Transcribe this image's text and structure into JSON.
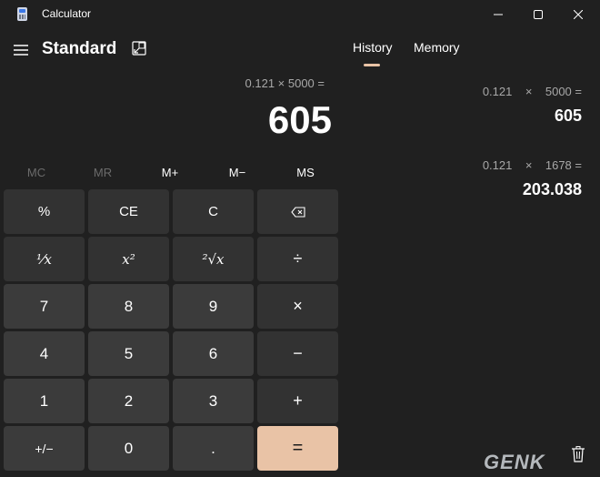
{
  "window": {
    "title": "Calculator",
    "minimize_icon": "minimize-icon",
    "maximize_icon": "maximize-icon",
    "close_icon": "close-icon"
  },
  "header": {
    "mode": "Standard",
    "tabs": [
      "History",
      "Memory"
    ],
    "active_tab": "History"
  },
  "display": {
    "expression": "0.121 × 5000 =",
    "result": "605"
  },
  "memory_row": [
    {
      "label": "MC",
      "enabled": false
    },
    {
      "label": "MR",
      "enabled": false
    },
    {
      "label": "M+",
      "enabled": true
    },
    {
      "label": "M−",
      "enabled": true
    },
    {
      "label": "MS",
      "enabled": true
    }
  ],
  "keys": {
    "percent": "%",
    "clear_entry": "CE",
    "clear": "C",
    "backspace_icon": "backspace-icon",
    "reciprocal": "⅟x",
    "square": "x²",
    "square_root": "²√x",
    "divide": "÷",
    "seven": "7",
    "eight": "8",
    "nine": "9",
    "multiply": "×",
    "four": "4",
    "five": "5",
    "six": "6",
    "minus": "−",
    "one": "1",
    "two": "2",
    "three": "3",
    "plus": "+",
    "negate": "+/−",
    "zero": "0",
    "decimal": ".",
    "equals": "="
  },
  "history": [
    {
      "expression_a": "0.121",
      "operator": "×",
      "expression_b": "5000",
      "equals": "=",
      "result": "605"
    },
    {
      "expression_a": "0.121",
      "operator": "×",
      "expression_b": "1678",
      "equals": "=",
      "result": "203.038"
    }
  ],
  "watermark": "GENK",
  "colors": {
    "background": "#202020",
    "key": "#3b3b3b",
    "key_fn": "#323232",
    "accent": "#e9c3a6",
    "muted_text": "#a8a8a8"
  }
}
